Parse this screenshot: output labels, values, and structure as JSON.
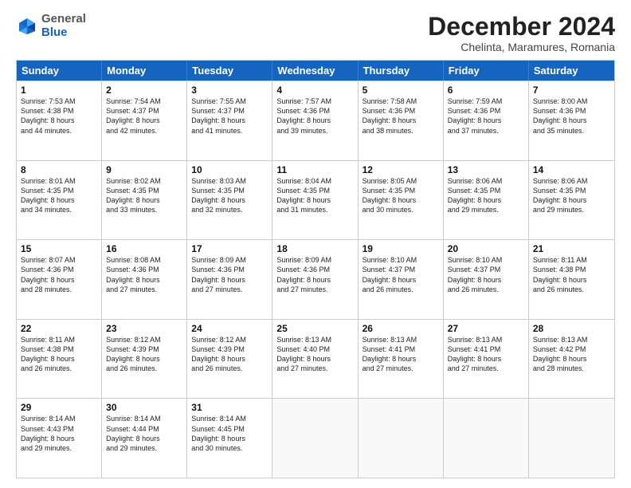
{
  "logo": {
    "general": "General",
    "blue": "Blue"
  },
  "title": "December 2024",
  "location": "Chelinta, Maramures, Romania",
  "header_days": [
    "Sunday",
    "Monday",
    "Tuesday",
    "Wednesday",
    "Thursday",
    "Friday",
    "Saturday"
  ],
  "weeks": [
    [
      {
        "day": "1",
        "lines": [
          "Sunrise: 7:53 AM",
          "Sunset: 4:38 PM",
          "Daylight: 8 hours",
          "and 44 minutes."
        ]
      },
      {
        "day": "2",
        "lines": [
          "Sunrise: 7:54 AM",
          "Sunset: 4:37 PM",
          "Daylight: 8 hours",
          "and 42 minutes."
        ]
      },
      {
        "day": "3",
        "lines": [
          "Sunrise: 7:55 AM",
          "Sunset: 4:37 PM",
          "Daylight: 8 hours",
          "and 41 minutes."
        ]
      },
      {
        "day": "4",
        "lines": [
          "Sunrise: 7:57 AM",
          "Sunset: 4:36 PM",
          "Daylight: 8 hours",
          "and 39 minutes."
        ]
      },
      {
        "day": "5",
        "lines": [
          "Sunrise: 7:58 AM",
          "Sunset: 4:36 PM",
          "Daylight: 8 hours",
          "and 38 minutes."
        ]
      },
      {
        "day": "6",
        "lines": [
          "Sunrise: 7:59 AM",
          "Sunset: 4:36 PM",
          "Daylight: 8 hours",
          "and 37 minutes."
        ]
      },
      {
        "day": "7",
        "lines": [
          "Sunrise: 8:00 AM",
          "Sunset: 4:36 PM",
          "Daylight: 8 hours",
          "and 35 minutes."
        ]
      }
    ],
    [
      {
        "day": "8",
        "lines": [
          "Sunrise: 8:01 AM",
          "Sunset: 4:35 PM",
          "Daylight: 8 hours",
          "and 34 minutes."
        ]
      },
      {
        "day": "9",
        "lines": [
          "Sunrise: 8:02 AM",
          "Sunset: 4:35 PM",
          "Daylight: 8 hours",
          "and 33 minutes."
        ]
      },
      {
        "day": "10",
        "lines": [
          "Sunrise: 8:03 AM",
          "Sunset: 4:35 PM",
          "Daylight: 8 hours",
          "and 32 minutes."
        ]
      },
      {
        "day": "11",
        "lines": [
          "Sunrise: 8:04 AM",
          "Sunset: 4:35 PM",
          "Daylight: 8 hours",
          "and 31 minutes."
        ]
      },
      {
        "day": "12",
        "lines": [
          "Sunrise: 8:05 AM",
          "Sunset: 4:35 PM",
          "Daylight: 8 hours",
          "and 30 minutes."
        ]
      },
      {
        "day": "13",
        "lines": [
          "Sunrise: 8:06 AM",
          "Sunset: 4:35 PM",
          "Daylight: 8 hours",
          "and 29 minutes."
        ]
      },
      {
        "day": "14",
        "lines": [
          "Sunrise: 8:06 AM",
          "Sunset: 4:35 PM",
          "Daylight: 8 hours",
          "and 29 minutes."
        ]
      }
    ],
    [
      {
        "day": "15",
        "lines": [
          "Sunrise: 8:07 AM",
          "Sunset: 4:36 PM",
          "Daylight: 8 hours",
          "and 28 minutes."
        ]
      },
      {
        "day": "16",
        "lines": [
          "Sunrise: 8:08 AM",
          "Sunset: 4:36 PM",
          "Daylight: 8 hours",
          "and 27 minutes."
        ]
      },
      {
        "day": "17",
        "lines": [
          "Sunrise: 8:09 AM",
          "Sunset: 4:36 PM",
          "Daylight: 8 hours",
          "and 27 minutes."
        ]
      },
      {
        "day": "18",
        "lines": [
          "Sunrise: 8:09 AM",
          "Sunset: 4:36 PM",
          "Daylight: 8 hours",
          "and 27 minutes."
        ]
      },
      {
        "day": "19",
        "lines": [
          "Sunrise: 8:10 AM",
          "Sunset: 4:37 PM",
          "Daylight: 8 hours",
          "and 26 minutes."
        ]
      },
      {
        "day": "20",
        "lines": [
          "Sunrise: 8:10 AM",
          "Sunset: 4:37 PM",
          "Daylight: 8 hours",
          "and 26 minutes."
        ]
      },
      {
        "day": "21",
        "lines": [
          "Sunrise: 8:11 AM",
          "Sunset: 4:38 PM",
          "Daylight: 8 hours",
          "and 26 minutes."
        ]
      }
    ],
    [
      {
        "day": "22",
        "lines": [
          "Sunrise: 8:11 AM",
          "Sunset: 4:38 PM",
          "Daylight: 8 hours",
          "and 26 minutes."
        ]
      },
      {
        "day": "23",
        "lines": [
          "Sunrise: 8:12 AM",
          "Sunset: 4:39 PM",
          "Daylight: 8 hours",
          "and 26 minutes."
        ]
      },
      {
        "day": "24",
        "lines": [
          "Sunrise: 8:12 AM",
          "Sunset: 4:39 PM",
          "Daylight: 8 hours",
          "and 26 minutes."
        ]
      },
      {
        "day": "25",
        "lines": [
          "Sunrise: 8:13 AM",
          "Sunset: 4:40 PM",
          "Daylight: 8 hours",
          "and 27 minutes."
        ]
      },
      {
        "day": "26",
        "lines": [
          "Sunrise: 8:13 AM",
          "Sunset: 4:41 PM",
          "Daylight: 8 hours",
          "and 27 minutes."
        ]
      },
      {
        "day": "27",
        "lines": [
          "Sunrise: 8:13 AM",
          "Sunset: 4:41 PM",
          "Daylight: 8 hours",
          "and 27 minutes."
        ]
      },
      {
        "day": "28",
        "lines": [
          "Sunrise: 8:13 AM",
          "Sunset: 4:42 PM",
          "Daylight: 8 hours",
          "and 28 minutes."
        ]
      }
    ],
    [
      {
        "day": "29",
        "lines": [
          "Sunrise: 8:14 AM",
          "Sunset: 4:43 PM",
          "Daylight: 8 hours",
          "and 29 minutes."
        ]
      },
      {
        "day": "30",
        "lines": [
          "Sunrise: 8:14 AM",
          "Sunset: 4:44 PM",
          "Daylight: 8 hours",
          "and 29 minutes."
        ]
      },
      {
        "day": "31",
        "lines": [
          "Sunrise: 8:14 AM",
          "Sunset: 4:45 PM",
          "Daylight: 8 hours",
          "and 30 minutes."
        ]
      },
      {
        "day": "",
        "lines": []
      },
      {
        "day": "",
        "lines": []
      },
      {
        "day": "",
        "lines": []
      },
      {
        "day": "",
        "lines": []
      }
    ]
  ]
}
